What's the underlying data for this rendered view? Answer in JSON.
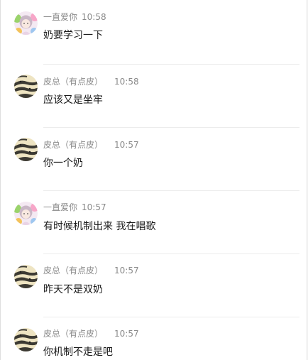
{
  "messages": [
    {
      "sender": "一直爱你",
      "time": "10:58",
      "text": " 奶要学习一下",
      "avatar": "girl-avatar"
    },
    {
      "sender": "皮总（有点皮）",
      "time": "10:58",
      "text": "应该又是坐牢",
      "avatar": "cat-avatar"
    },
    {
      "sender": "皮总（有点皮）",
      "time": "10:57",
      "text": "你一个奶",
      "avatar": "cat-avatar"
    },
    {
      "sender": "一直爱你",
      "time": "10:57",
      "text": " 有时候机制出来 我在唱歌",
      "avatar": "girl-avatar"
    },
    {
      "sender": "皮总（有点皮）",
      "time": "10:57",
      "text": "昨天不是双奶",
      "avatar": "cat-avatar"
    },
    {
      "sender": "皮总（有点皮）",
      "time": "10:57",
      "text": "你机制不走是吧",
      "avatar": "cat-avatar"
    }
  ]
}
